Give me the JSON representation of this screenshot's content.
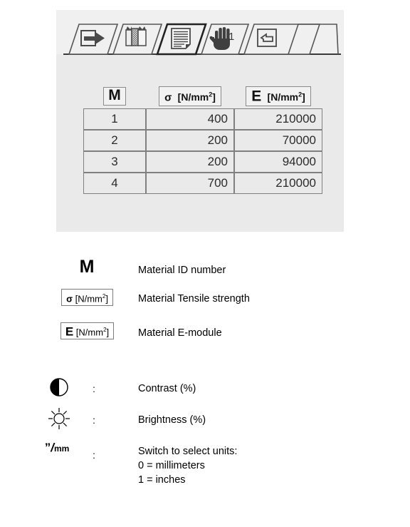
{
  "panel": {
    "tabs": [
      {
        "id": "tab-goto",
        "icon": "arrow-right-into-box-icon",
        "label": "",
        "selected": false
      },
      {
        "id": "tab-materials",
        "icon": "layers-hatched-icon",
        "label": "",
        "selected": false
      },
      {
        "id": "tab-document",
        "icon": "lined-document-icon",
        "label": "",
        "selected": true
      },
      {
        "id": "tab-hand",
        "icon": "hand-icon",
        "label": "",
        "selected": false
      },
      {
        "id": "tab-enter",
        "icon": "return-arrow-box-icon",
        "label": "1",
        "selected": false
      }
    ],
    "table": {
      "headers": [
        {
          "symbol": "M",
          "unit": ""
        },
        {
          "symbol": "σ",
          "unit": "[N/mm2]"
        },
        {
          "symbol": "E",
          "unit": "[N/mm2]"
        }
      ],
      "rows": [
        {
          "id": "1",
          "sigma": "400",
          "emodule": "210000",
          "selected_cell": "sigma"
        },
        {
          "id": "2",
          "sigma": "200",
          "emodule": "70000",
          "selected_cell": ""
        },
        {
          "id": "3",
          "sigma": "200",
          "emodule": "94000",
          "selected_cell": ""
        },
        {
          "id": "4",
          "sigma": "700",
          "emodule": "210000",
          "selected_cell": ""
        }
      ]
    }
  },
  "legend": {
    "items": [
      {
        "symbol_kind": "text-m",
        "symbol_text": "M",
        "colon": "",
        "description": "Material ID number"
      },
      {
        "symbol_kind": "box-sigma",
        "symbol_text": "σ [N/mm2]",
        "colon": "",
        "description": "Material Tensile strength"
      },
      {
        "symbol_kind": "box-e",
        "symbol_text": "E [N/mm2]",
        "colon": "",
        "description": "Material E-module"
      },
      {
        "symbol_kind": "contrast",
        "symbol_text": "",
        "colon": ":",
        "description": "Contrast (%)"
      },
      {
        "symbol_kind": "brightness",
        "symbol_text": "",
        "colon": ":",
        "description": "Brightness (%)"
      },
      {
        "symbol_kind": "units",
        "symbol_text": "\"/mm",
        "colon": ":",
        "description": "Switch to select units:\n0 = millimeters\n1 = inches"
      }
    ]
  },
  "colors": {
    "panel_bg": "#eaeaea",
    "tabstrip_bg": "#f0f0f0",
    "selected_cell_bg": "#333333",
    "cell_bg": "#eaeaea",
    "border": "#808080",
    "icon": "#4a4a4a"
  }
}
